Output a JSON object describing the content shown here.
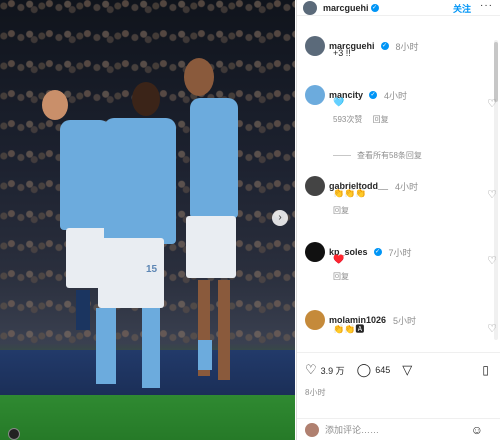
{
  "header": {
    "username": "marcguehi",
    "follow_label": "关注",
    "more_label": "···"
  },
  "photo": {
    "shorts_number": "15"
  },
  "comments": [
    {
      "username": "marcguehi",
      "verified": true,
      "time": "8小时",
      "text": "+3 !!",
      "avatar_color": "#5b6a7a"
    },
    {
      "username": "mancity",
      "verified": true,
      "time": "4小时",
      "text": "🩵",
      "likes": "593次赞",
      "reply_label": "回复",
      "view_replies": "查看所有58条回复",
      "avatar_color": "#6cabdd"
    },
    {
      "username": "gabrieltodd__",
      "verified": false,
      "time": "4小时",
      "text": "👏👏👏",
      "reply_label": "回复",
      "avatar_color": "#444444"
    },
    {
      "username": "kp_soles",
      "verified": true,
      "time": "7小时",
      "text": "♥️",
      "reply_label": "回复",
      "avatar_color": "#111111"
    },
    {
      "username": "molamin1026",
      "verified": false,
      "time": "5小时",
      "text": "👏👏🅰",
      "avatar_color": "#c58a3a"
    }
  ],
  "actions": {
    "likes_count": "3.9 万",
    "comments_count": "645",
    "posted": "8小时"
  },
  "add_comment": {
    "placeholder": "添加评论……"
  }
}
